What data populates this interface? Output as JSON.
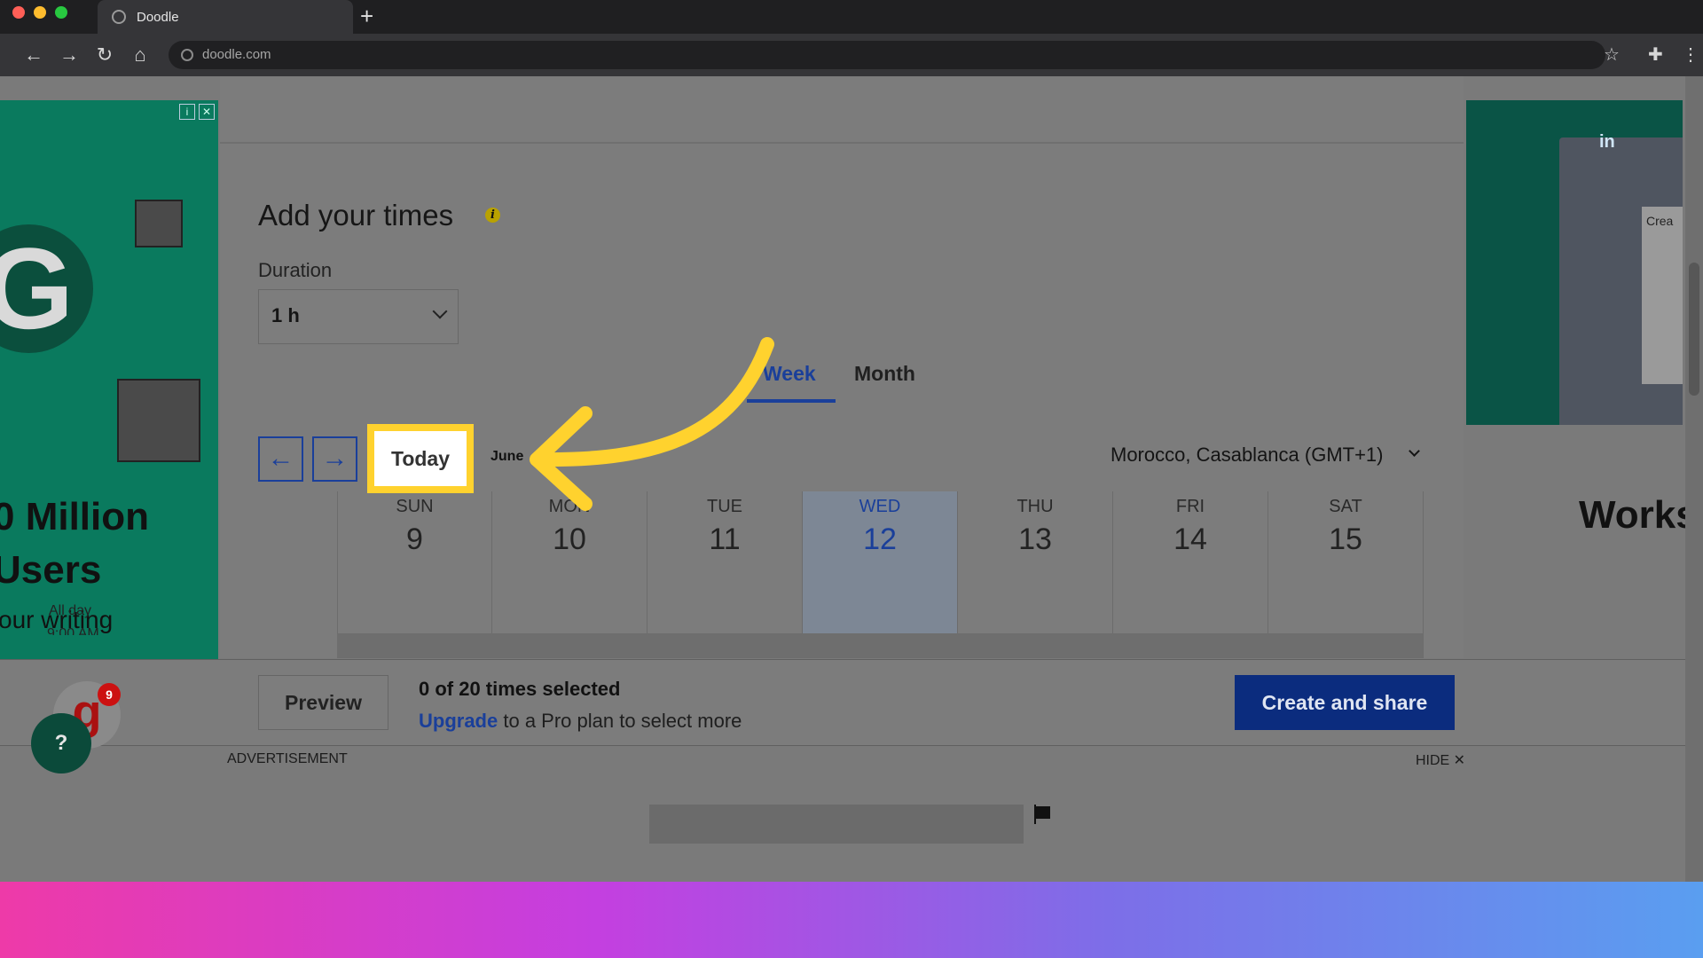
{
  "browser": {
    "tab_title": "Doodle",
    "new_tab": "+",
    "url": "doodle.com"
  },
  "ads": {
    "left_headline": "0 Million\nUsers",
    "left_sub": "our writing",
    "right_heading": "Works",
    "right_li": "in",
    "right_crea": "Crea"
  },
  "page": {
    "title": "Add your times",
    "duration_label": "Duration",
    "duration_value": "1 h",
    "view_tabs": {
      "week": "Week",
      "month": "Month",
      "active": "Week"
    },
    "today_button": "Today",
    "month_label": "June",
    "timezone": "Morocco, Casablanca (GMT+1)",
    "days": [
      {
        "name": "SUN",
        "date": "9",
        "today": false
      },
      {
        "name": "MON",
        "date": "10",
        "today": false
      },
      {
        "name": "TUE",
        "date": "11",
        "today": false
      },
      {
        "name": "WED",
        "date": "12",
        "today": true
      },
      {
        "name": "THU",
        "date": "13",
        "today": false
      },
      {
        "name": "FRI",
        "date": "14",
        "today": false
      },
      {
        "name": "SAT",
        "date": "15",
        "today": false
      }
    ],
    "all_day_label": "All day",
    "time_row_label": "9:00 AM"
  },
  "actionbar": {
    "preview": "Preview",
    "selected_count": "0 of 20 times selected",
    "upgrade_link": "Upgrade",
    "upgrade_rest": " to a Pro plan to select more",
    "create": "Create and share"
  },
  "adstrip": {
    "label": "ADVERTISEMENT",
    "hide": "HIDE ✕"
  },
  "widgets": {
    "grammarly_badge": "9",
    "help": "?"
  },
  "colors": {
    "accent": "#1a3f9a",
    "highlight": "#ffd22e",
    "create_button": "#0b2c7e"
  }
}
